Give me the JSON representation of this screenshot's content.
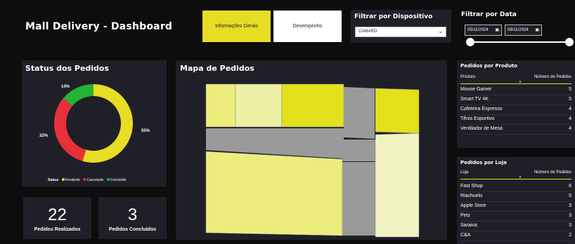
{
  "header": {
    "title": "Mall Delivery - Dashboard",
    "tabs": [
      {
        "label": "Informações Gerais",
        "active": true
      },
      {
        "label": "Desempenho",
        "active": false
      }
    ]
  },
  "device_filter": {
    "label": "Filtrar por Dispositivo",
    "selected": "CAMARO"
  },
  "date_filter": {
    "label": "Filtrar por Data",
    "start": "05/11/2024",
    "end": "08/11/2024"
  },
  "status_panel": {
    "title": "Status dos Pedidos",
    "legend_title": "Status",
    "slices": [
      {
        "label": "Pendente",
        "percent": 55,
        "percent_label": "55%",
        "color": "#e6dd24"
      },
      {
        "label": "Cancelado",
        "percent": 32,
        "percent_label": "32%",
        "color": "#e8303d"
      },
      {
        "label": "Concluído",
        "percent": 14,
        "percent_label": "14%",
        "color": "#25b337"
      }
    ]
  },
  "kpis": [
    {
      "value": "22",
      "label": "Pedidos Realizados"
    },
    {
      "value": "3",
      "label": "Pedidos Concluídos"
    }
  ],
  "map_panel": {
    "title": "Mapa de Pedidos",
    "colors": {
      "light": "#eced7d",
      "pale": "#edefa5",
      "bright": "#e3e01c",
      "road": "#9a9a9a",
      "cream": "#f1f3c3"
    }
  },
  "products_table": {
    "title": "Pedidos por Produto",
    "columns": [
      "Produto",
      "Número de Pedidos"
    ],
    "rows": [
      [
        "Mouse Gamer",
        "5"
      ],
      [
        "Smart TV 4K",
        "5"
      ],
      [
        "Cafeteira Expresso",
        "4"
      ],
      [
        "Tênis Esportivo",
        "4"
      ],
      [
        "Ventilador de Mesa",
        "4"
      ]
    ]
  },
  "stores_table": {
    "title": "Pedidos por Loja",
    "columns": [
      "Loja",
      "Número de Pedidos"
    ],
    "rows": [
      [
        "Fast Shop",
        "6"
      ],
      [
        "Riachuelo",
        "5"
      ],
      [
        "Apple Store",
        "3"
      ],
      [
        "Petz",
        "3"
      ],
      [
        "Saraiva",
        "3"
      ],
      [
        "C&A",
        "2"
      ]
    ]
  },
  "colors": {
    "accent": "#e6dd24",
    "panel": "#1f2027",
    "background": "#0d0d0d"
  }
}
